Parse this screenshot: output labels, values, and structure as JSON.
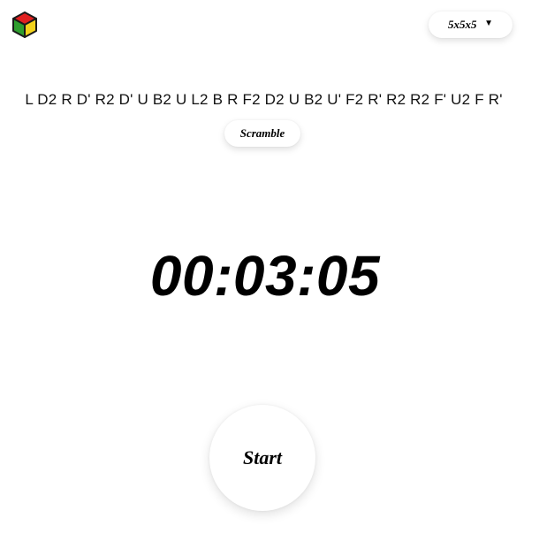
{
  "header": {
    "logo_icon": "rubiks-cube-icon",
    "logo_colors": {
      "top": "#e02020",
      "left": "#2e9e2e",
      "right": "#f2d21b",
      "edge": "#1a1a1a"
    },
    "puzzle_select": {
      "value": "5x5x5",
      "caret": "▼",
      "caret_icon": "caret-down-icon"
    }
  },
  "scramble": {
    "sequence": "L D2 R D' R2 D' U B2 U L2 B R F2 D2 U B2 U' F2 R' R2 R2 F' U2 F R'",
    "button_label": "Scramble"
  },
  "timer": {
    "display": "00:03:05"
  },
  "controls": {
    "start_label": "Start"
  }
}
